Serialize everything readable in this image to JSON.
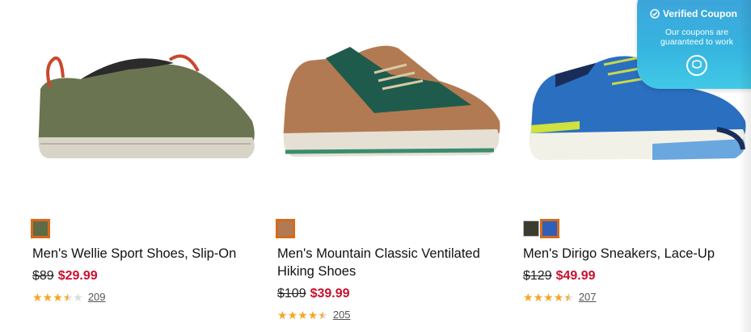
{
  "products": [
    {
      "name": "Men's Wellie Sport Shoes, Slip-On",
      "price_old": "$89",
      "price_new": "$29.99",
      "rating": 3.5,
      "review_count": "209",
      "swatch_colors": [
        "#5e6b44"
      ],
      "selected_swatch": 0,
      "shoe_icon": "slip-on-shoe-icon"
    },
    {
      "name": "Men's Mountain Classic Ventilated Hiking Shoes",
      "price_old": "$109",
      "price_new": "$39.99",
      "rating": 4.5,
      "review_count": "205",
      "swatch_colors": [
        "#b07a54"
      ],
      "selected_swatch": 0,
      "shoe_icon": "hiking-shoe-icon"
    },
    {
      "name": "Men's Dirigo Sneakers, Lace-Up",
      "price_old": "$129",
      "price_new": "$49.99",
      "rating": 4.5,
      "review_count": "207",
      "swatch_colors": [
        "#3c3b2f",
        "#2f5fb8"
      ],
      "selected_swatch": 1,
      "shoe_icon": "sneaker-icon"
    }
  ],
  "coupon": {
    "title": "Verified Coupon",
    "subtitle": "Our coupons are guaranteed to work",
    "icon": "coupon-badge-icon"
  },
  "colors": {
    "sale_red": "#c8102e",
    "star_gold": "#f5a623",
    "selected_outline": "#d66a1a",
    "coupon_blue": "#36b4e0"
  }
}
